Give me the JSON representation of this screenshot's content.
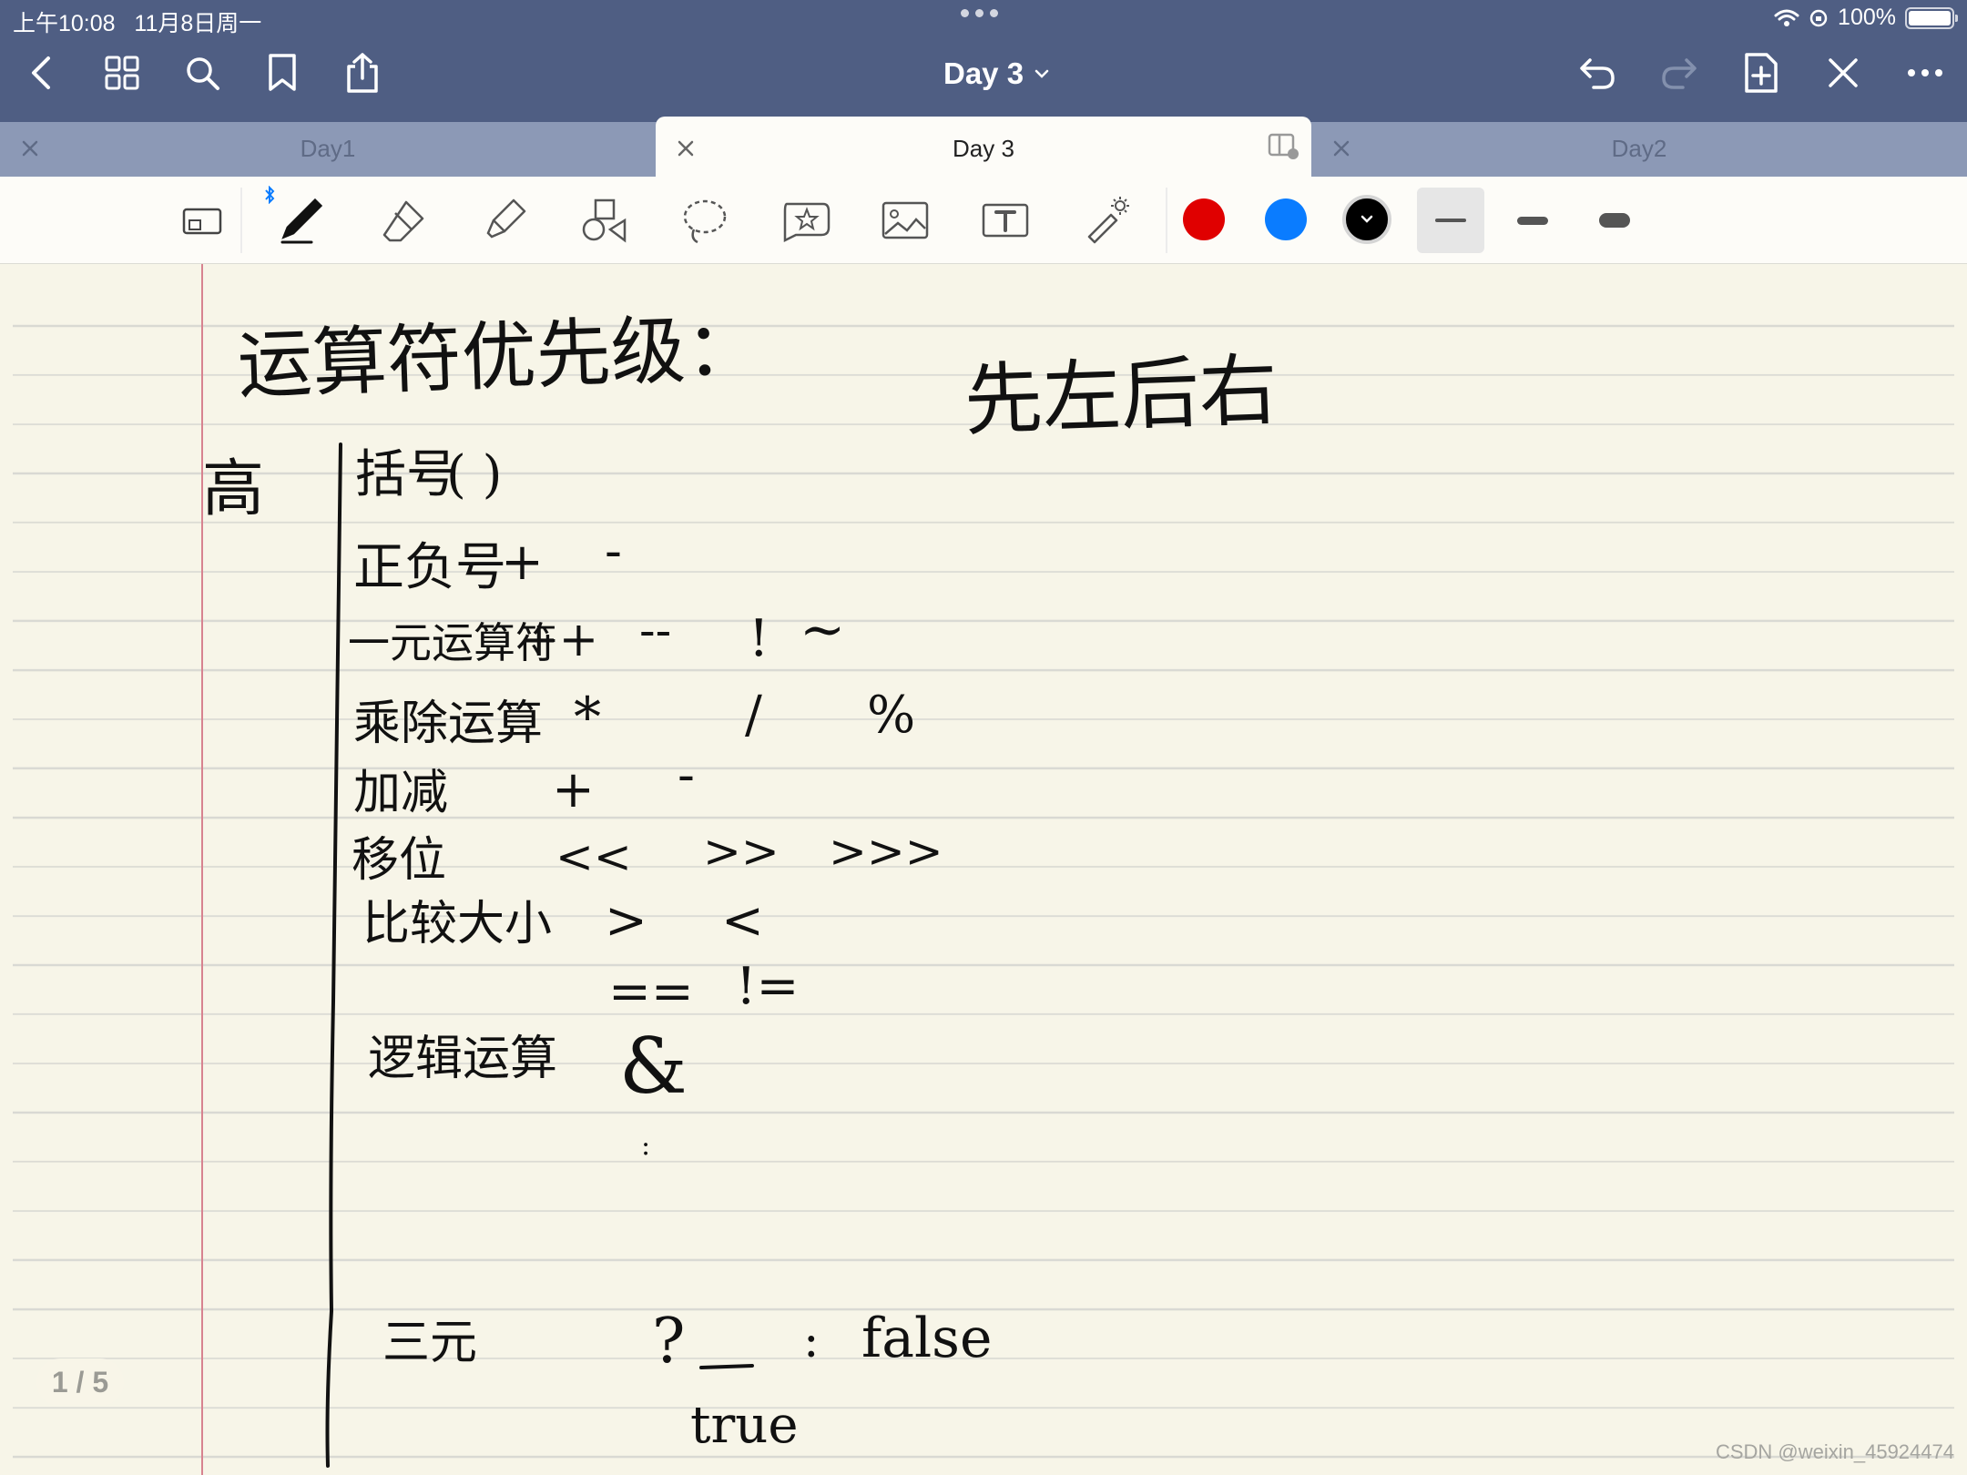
{
  "status_bar": {
    "time": "上午10:08",
    "date": "11月8日周一",
    "battery": "100%"
  },
  "header": {
    "title": "Day 3"
  },
  "tabs": [
    {
      "label": "Day1",
      "active": false
    },
    {
      "label": "Day 3",
      "active": true
    },
    {
      "label": "Day2",
      "active": false
    }
  ],
  "toolbar": {
    "colors": [
      "#e00000",
      "#0a7cff",
      "#000000"
    ],
    "selected_color": "#000000",
    "stroke_widths": [
      "thin",
      "medium",
      "thick"
    ],
    "selected_width": "thin"
  },
  "note": {
    "heading": "运算符优先级：",
    "associativity": "先左后右",
    "high_marker": "高",
    "rows": [
      {
        "label": "括号",
        "operators": [
          "( )"
        ]
      },
      {
        "label": "正负号",
        "operators": [
          "+",
          "-"
        ]
      },
      {
        "label": "一元运算符",
        "operators": [
          "++",
          "--",
          "!",
          "~"
        ]
      },
      {
        "label": "乘除运算",
        "operators": [
          "*",
          "/",
          "%"
        ]
      },
      {
        "label": "加减",
        "operators": [
          "+",
          "-"
        ]
      },
      {
        "label": "移位",
        "operators": [
          "<<",
          ">>",
          ">>>"
        ]
      },
      {
        "label": "比较大小",
        "operators": [
          ">",
          "<"
        ]
      },
      {
        "label": "",
        "operators": [
          "==",
          "!="
        ]
      },
      {
        "label": "逻辑运算",
        "operators": [
          "&",
          ":"
        ]
      },
      {
        "label": "三元",
        "operators": [
          "?",
          ":",
          "true",
          "false"
        ]
      }
    ]
  },
  "page_indicator": "1 / 5",
  "watermark": "CSDN @weixin_45924474"
}
